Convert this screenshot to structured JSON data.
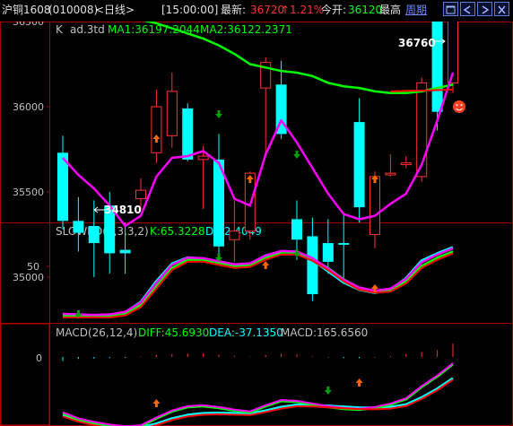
{
  "header": {
    "symbol": "沪铜1608",
    "code": "(010008)",
    "period": "<日线>",
    "time": "[15:00:00]",
    "latest_label": "最新:",
    "latest_value": "36720",
    "change_pct": "↑1.21%",
    "open_label": "今开:",
    "open_value": "36120",
    "high_label": "最高",
    "period_link": "周期",
    "window_buttons": [
      "restore-icon",
      "prev-icon",
      "next-icon",
      "close-icon"
    ]
  },
  "main_panel": {
    "type_label": "K",
    "name_label": "ad.3td",
    "ma1_label": "MA1:36197.2044",
    "ma2_label": "MA2:36122.2371",
    "y_ticks": [
      "36500",
      "36000",
      "35500",
      "35000"
    ],
    "y_tick_values": [
      36500,
      36000,
      35500,
      35000
    ],
    "high_marker": "36760",
    "low_marker": "34810",
    "smiley_icon": "smiley-face-icon"
  },
  "kd_panel": {
    "name_label": "SLOWKD(9,3,3,2)",
    "k_label": "K:65.3228",
    "d_label": "D:62.4049",
    "y_tick": "50"
  },
  "macd_panel": {
    "name_label": "MACD(26,12,4)",
    "diff_label": "DIFF:45.6930",
    "dea_label": "DEA:-37.1350",
    "macd_label": "MACD:165.6560",
    "y_tick": "0"
  },
  "colors": {
    "up": "#ff3232",
    "down": "#00ffff",
    "ma1": "#ff00ff",
    "ma2": "#00ff00",
    "red_line": "#ff0000",
    "frame": "#a00000",
    "label_gray": "#c0c0c0",
    "arrow_up": "#ff6600",
    "arrow_down": "#00a000"
  },
  "chart_data": {
    "type": "candlestick",
    "candles": [
      {
        "o": 35730,
        "h": 35830,
        "l": 35280,
        "c": 35330
      },
      {
        "o": 35330,
        "h": 35470,
        "l": 35150,
        "c": 35260
      },
      {
        "o": 35300,
        "h": 35450,
        "l": 35000,
        "c": 35200
      },
      {
        "o": 35420,
        "h": 35500,
        "l": 35020,
        "c": 35140
      },
      {
        "o": 35160,
        "h": 35320,
        "l": 35020,
        "c": 35140
      },
      {
        "o": 35460,
        "h": 35580,
        "l": 35390,
        "c": 35510
      },
      {
        "o": 35730,
        "h": 36100,
        "l": 35670,
        "c": 36000
      },
      {
        "o": 35830,
        "h": 36200,
        "l": 35760,
        "c": 36090
      },
      {
        "o": 35990,
        "h": 36020,
        "l": 35680,
        "c": 35690
      },
      {
        "o": 35690,
        "h": 35770,
        "l": 35400,
        "c": 35710
      },
      {
        "o": 35690,
        "h": 35840,
        "l": 35130,
        "c": 35180
      },
      {
        "o": 35220,
        "h": 35450,
        "l": 35090,
        "c": 35270
      },
      {
        "o": 35270,
        "h": 35620,
        "l": 35220,
        "c": 35610
      },
      {
        "o": 36110,
        "h": 36290,
        "l": 35710,
        "c": 36260
      },
      {
        "o": 36130,
        "h": 36270,
        "l": 35810,
        "c": 35840
      },
      {
        "o": 35340,
        "h": 35450,
        "l": 35100,
        "c": 35220
      },
      {
        "o": 35240,
        "h": 35350,
        "l": 34860,
        "c": 34900
      },
      {
        "o": 35200,
        "h": 35340,
        "l": 35020,
        "c": 35090
      },
      {
        "o": 35200,
        "h": 35380,
        "l": 34990,
        "c": 35190
      },
      {
        "o": 35910,
        "h": 36050,
        "l": 35320,
        "c": 35410
      },
      {
        "o": 35250,
        "h": 35620,
        "l": 35170,
        "c": 35590
      },
      {
        "o": 35600,
        "h": 35720,
        "l": 35590,
        "c": 35610
      },
      {
        "o": 35660,
        "h": 35710,
        "l": 35640,
        "c": 35670
      },
      {
        "o": 35590,
        "h": 36170,
        "l": 35560,
        "c": 36140
      },
      {
        "o": 36530,
        "h": 36570,
        "l": 35860,
        "c": 35970
      },
      {
        "o": 36140,
        "h": 36740,
        "l": 36080,
        "c": 36720
      }
    ],
    "ma1": [
      35700,
      35600,
      35520,
      35420,
      35300,
      35360,
      35590,
      35700,
      35710,
      35740,
      35670,
      35460,
      35420,
      35720,
      35920,
      35790,
      35640,
      35490,
      35370,
      35340,
      35360,
      35430,
      35490,
      35660,
      35920,
      36200
    ],
    "ma2": [
      36780,
      36700,
      36640,
      36580,
      36530,
      36510,
      36490,
      36460,
      36430,
      36400,
      36360,
      36310,
      36250,
      36230,
      36210,
      36200,
      36180,
      36140,
      36120,
      36110,
      36090,
      36080,
      36080,
      36090,
      36110,
      36130
    ],
    "kd_k": [
      3,
      2,
      1,
      2,
      5,
      15,
      35,
      52,
      58,
      57,
      54,
      51,
      52,
      60,
      64,
      63,
      56,
      45,
      34,
      27,
      24,
      27,
      38,
      55,
      62,
      68
    ],
    "kd_d": [
      2,
      2,
      2,
      2,
      4,
      12,
      30,
      48,
      56,
      56,
      53,
      50,
      51,
      58,
      63,
      63,
      57,
      48,
      37,
      29,
      26,
      27,
      35,
      50,
      58,
      64
    ],
    "macd_diff": [
      -230,
      -265,
      -285,
      -300,
      -310,
      -305,
      -260,
      -220,
      -195,
      -190,
      -200,
      -215,
      -225,
      -190,
      -160,
      -165,
      -180,
      -195,
      -205,
      -210,
      -200,
      -180,
      -150,
      -80,
      -20,
      50
    ],
    "macd_dea": [
      -240,
      -270,
      -290,
      -305,
      -315,
      -310,
      -290,
      -260,
      -240,
      -230,
      -228,
      -230,
      -232,
      -215,
      -195,
      -182,
      -183,
      -188,
      -193,
      -198,
      -199,
      -195,
      -180,
      -140,
      -90,
      -30
    ],
    "macd_hist": [
      -50,
      -25,
      -20,
      -15,
      -10,
      5,
      25,
      35,
      40,
      40,
      28,
      15,
      5,
      25,
      40,
      30,
      8,
      -5,
      -15,
      -15,
      -5,
      12,
      35,
      60,
      85,
      165
    ]
  }
}
